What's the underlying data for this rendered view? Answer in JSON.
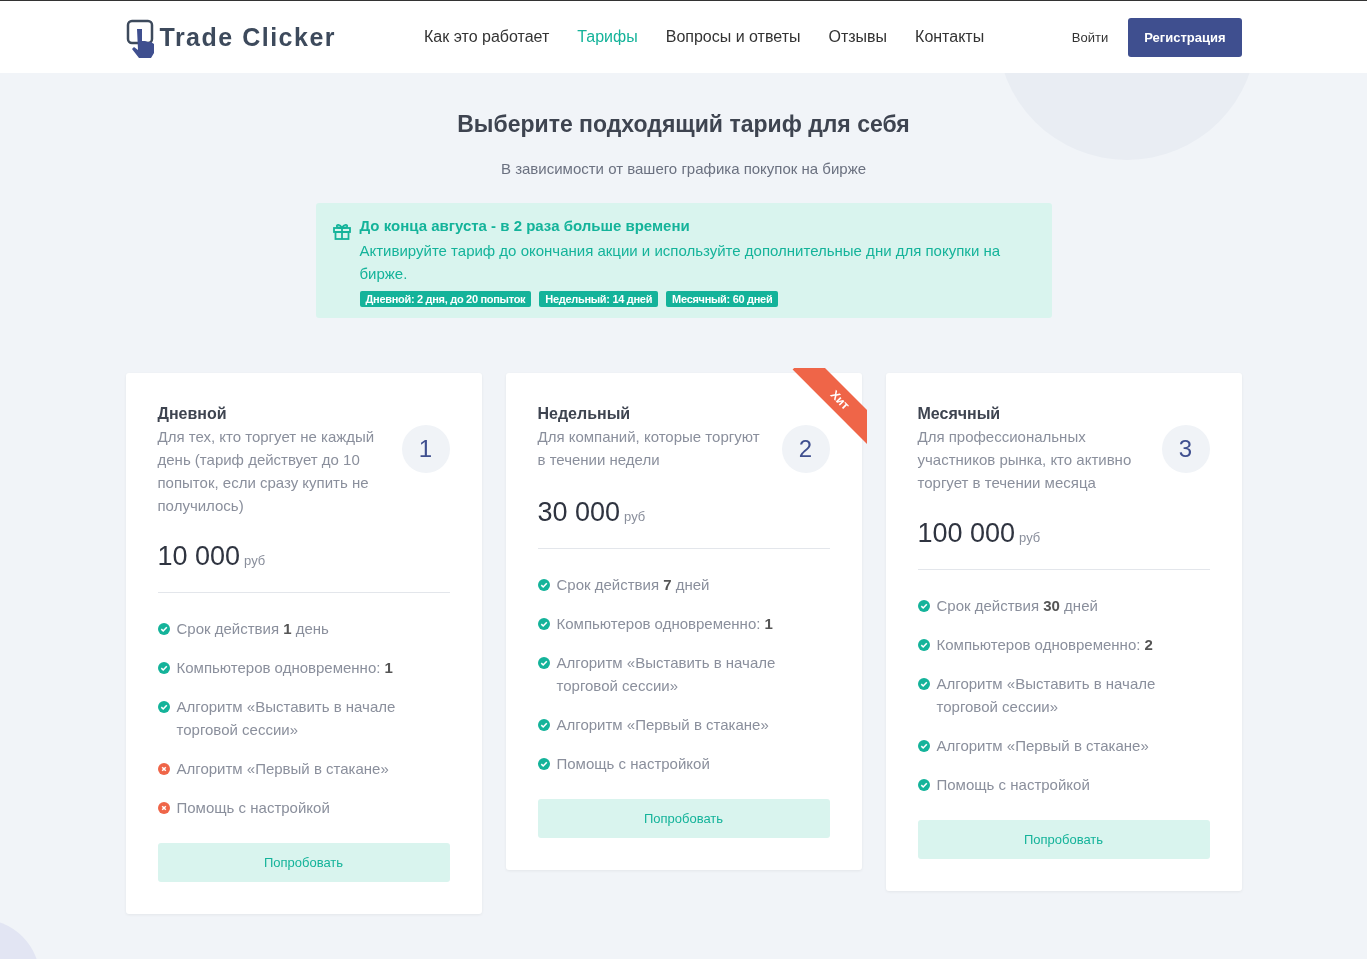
{
  "header": {
    "logo": "Trade Clicker",
    "nav": [
      {
        "label": "Как это работает",
        "selected": false
      },
      {
        "label": "Тарифы",
        "selected": true
      },
      {
        "label": "Вопросы и ответы",
        "selected": false
      },
      {
        "label": "Отзывы",
        "selected": false
      },
      {
        "label": "Контакты",
        "selected": false
      }
    ],
    "login": "Войти",
    "register": "Регистрация"
  },
  "title": "Выберите подходящий тариф для себя",
  "subtitle": "В зависимости от вашего графика покупок на бирже",
  "promo": {
    "title": "До конца августа - в 2 раза больше времени",
    "text": "Активируйте тариф до окончания акции и используйте дополнительные дни для покупки на бирже.",
    "tags": [
      "Дневной: 2 дня, до 20 попыток",
      "Недельный: 14 дней",
      "Месячный: 60 дней"
    ]
  },
  "plans": [
    {
      "name": "Дневной",
      "description": "Для тех, кто торгует не каждый день (тариф действует до 10 попыток, если сразу купить не получилось)",
      "number": "1",
      "price": "10 000",
      "currency": "руб",
      "features": [
        {
          "text": "Срок действия **1** день",
          "included": true
        },
        {
          "text": "Компьютеров одновременно: **1**",
          "included": true
        },
        {
          "text": "Алгоритм «Выставить в начале торговой сессии»",
          "included": true
        },
        {
          "text": "Алгоритм «Первый в стакане»",
          "included": false
        },
        {
          "text": "Помощь с настройкой",
          "included": false
        }
      ],
      "button": "Попробовать"
    },
    {
      "name": "Недельный",
      "description": "Для компаний, которые торгуют в течении недели",
      "number": "2",
      "price": "30 000",
      "currency": "руб",
      "ribbon": "Хит",
      "features": [
        {
          "text": "Срок действия **7** дней",
          "included": true
        },
        {
          "text": "Компьютеров одновременно: **1**",
          "included": true
        },
        {
          "text": "Алгоритм «Выставить в начале торговой сессии»",
          "included": true
        },
        {
          "text": "Алгоритм «Первый в стакане»",
          "included": true
        },
        {
          "text": "Помощь с настройкой",
          "included": true
        }
      ],
      "button": "Попробовать"
    },
    {
      "name": "Месячный",
      "description": "Для профессиональных участников рынка, кто активно торгует в течении месяца",
      "number": "3",
      "price": "100 000",
      "currency": "руб",
      "features": [
        {
          "text": "Срок действия **30** дней",
          "included": true
        },
        {
          "text": "Компьютеров одновременно: **2**",
          "included": true
        },
        {
          "text": "Алгоритм «Выставить в начале торговой сессии»",
          "included": true
        },
        {
          "text": "Алгоритм «Первый в стакане»",
          "included": true
        },
        {
          "text": "Помощь с настройкой",
          "included": true
        }
      ],
      "button": "Попробовать"
    }
  ]
}
